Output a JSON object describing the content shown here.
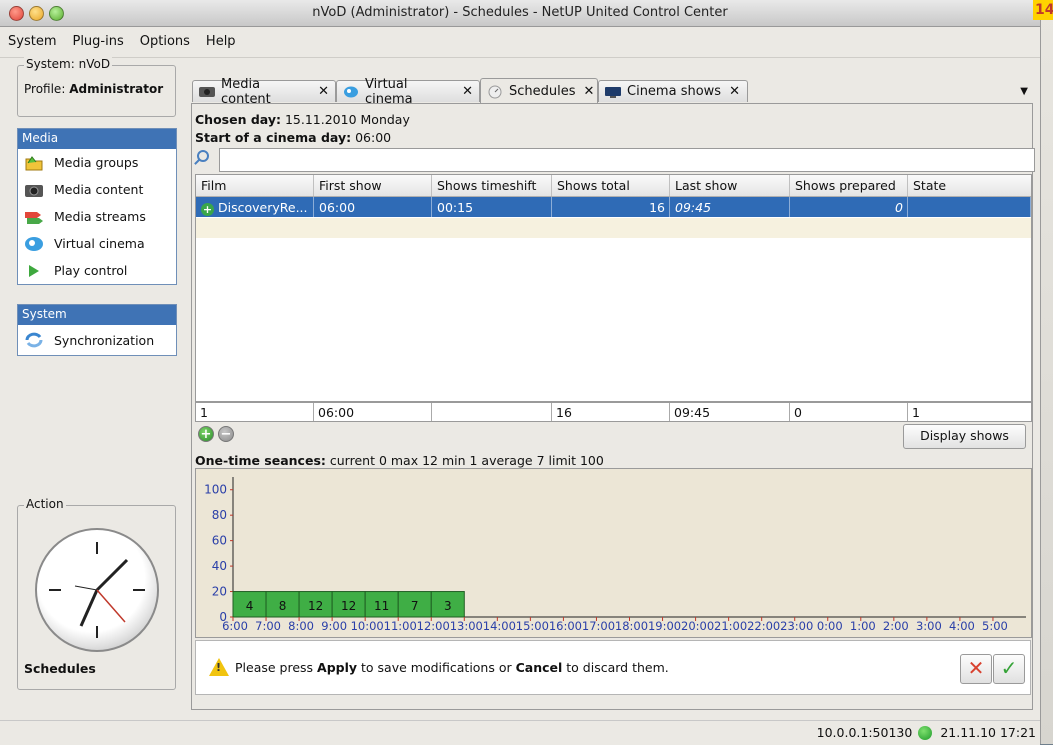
{
  "window": {
    "title": "nVoD (Administrator) - Schedules - NetUP United Control Center",
    "corner_badge": "14"
  },
  "menu": [
    "System",
    "Plug-ins",
    "Options",
    "Help"
  ],
  "system_box": {
    "legend": "System: nVoD",
    "profile_label": "Profile:",
    "profile_value": "Administrator"
  },
  "media_panel": {
    "title": "Media",
    "items": [
      {
        "label": "Media groups",
        "icon": "folder-icon"
      },
      {
        "label": "Media content",
        "icon": "camera-icon"
      },
      {
        "label": "Media streams",
        "icon": "streams-icon"
      },
      {
        "label": "Virtual cinema",
        "icon": "cinema-icon"
      },
      {
        "label": "Play control",
        "icon": "play-icon"
      }
    ]
  },
  "system_panel": {
    "title": "System",
    "items": [
      {
        "label": "Synchronization",
        "icon": "sync-icon"
      }
    ]
  },
  "action_box": {
    "legend": "Action",
    "label": "Schedules"
  },
  "tabs": [
    {
      "label": "Media content",
      "icon": "camera-icon"
    },
    {
      "label": "Virtual cinema",
      "icon": "cinema-icon"
    },
    {
      "label": "Schedules",
      "icon": "clock-icon",
      "active": true
    },
    {
      "label": "Cinema shows",
      "icon": "screen-icon"
    }
  ],
  "schedule": {
    "chosen_day_label": "Chosen day:",
    "chosen_day_value": "15.11.2010 Monday",
    "start_label": "Start of a cinema day:",
    "start_value": "06:00",
    "search_value": ""
  },
  "table": {
    "columns": [
      "Film",
      "First show",
      "Shows timeshift",
      "Shows total",
      "Last show",
      "Shows prepared",
      "State"
    ],
    "rows": [
      [
        "DiscoveryRe...",
        "06:00",
        "00:15",
        "16",
        "09:45",
        "0",
        ""
      ]
    ],
    "footer": [
      "1",
      "06:00",
      "",
      "16",
      "09:45",
      "0",
      "1"
    ]
  },
  "buttons": {
    "display_shows": "Display shows"
  },
  "seances": {
    "label": "One-time seances:",
    "summary": "current 0 max 12 min 1 average 7 limit 100"
  },
  "notice": {
    "prefix": "Please press ",
    "apply": "Apply",
    "middle": " to save modifications or ",
    "cancel": "Cancel",
    "suffix": " to discard them."
  },
  "status": {
    "address": "10.0.0.1:50130",
    "datetime": "21.11.10 17:21",
    "indicator_color": "#2fb838"
  },
  "colors": {
    "selection": "#2f6bb6",
    "panel_header": "#3f73b5",
    "bar": "#3fae45"
  },
  "chart_data": {
    "type": "bar",
    "categories": [
      "6:00",
      "7:00",
      "8:00",
      "9:00",
      "10:00",
      "11:00",
      "12:00",
      "13:00",
      "14:00",
      "15:00",
      "16:00",
      "17:00",
      "18:00",
      "19:00",
      "20:00",
      "21:00",
      "22:00",
      "23:00",
      "0:00",
      "1:00",
      "2:00",
      "3:00",
      "4:00",
      "5:00"
    ],
    "values": [
      4,
      8,
      12,
      12,
      11,
      7,
      3,
      null,
      null,
      null,
      null,
      null,
      null,
      null,
      null,
      null,
      null,
      null,
      null,
      null,
      null,
      null,
      null,
      null
    ],
    "yticks": [
      0,
      20,
      40,
      60,
      80,
      100
    ],
    "ylim": [
      0,
      110
    ],
    "title": "",
    "xlabel": "",
    "ylabel": ""
  }
}
